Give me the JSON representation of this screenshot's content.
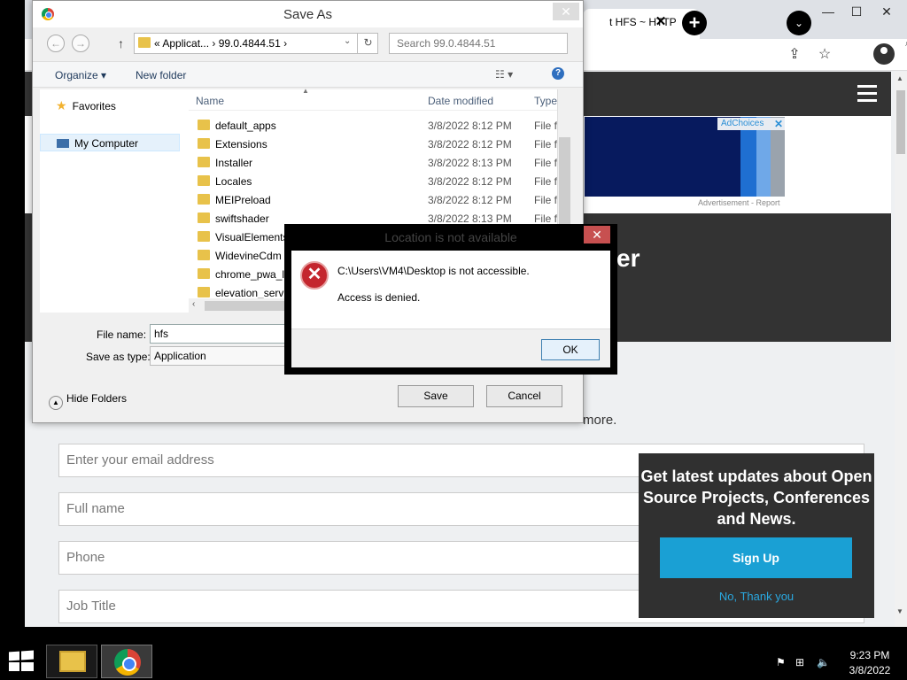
{
  "chrome": {
    "tab_title": "t HFS ~ HTTP",
    "tab_close": "✕",
    "new_tab": "+",
    "tab_search": "⌄",
    "minimize": "—",
    "maximize": "☐",
    "close": "✕",
    "share_icon": "⇪",
    "star_icon": "☆",
    "menu_icon": "⋮"
  },
  "page": {
    "adchoices": "AdChoices",
    "adchoices_close": "✕",
    "ad_label": "Advertisement - Report",
    "hero_partial": "er",
    "subscribe_partial": "more.",
    "form": {
      "email_placeholder": "Enter your email address",
      "fullname_placeholder": "Full name",
      "phone_placeholder": "Phone",
      "jobtitle_placeholder": "Job Title"
    },
    "popup": {
      "title": "Get latest updates about Open Source Projects, Conferences and News.",
      "signup": "Sign Up",
      "nothanks": "No, Thank you"
    }
  },
  "saveas": {
    "title": "Save As",
    "close": "✕",
    "back": "←",
    "forward": "→",
    "up": "↑",
    "address": "« Applicat... › 99.0.4844.51 ›",
    "address_dd": "⌄",
    "refresh": "↻",
    "search_placeholder": "Search 99.0.4844.51",
    "organize": "Organize ▾",
    "new_folder": "New folder",
    "view_options": "☷ ▾",
    "help": "?",
    "nav": {
      "favorites": "Favorites",
      "my_computer": "My Computer"
    },
    "columns": {
      "name": "Name",
      "date": "Date modified",
      "type": "Type"
    },
    "files": [
      {
        "name": "default_apps",
        "date": "3/8/2022 8:12 PM",
        "type": "File fol"
      },
      {
        "name": "Extensions",
        "date": "3/8/2022 8:12 PM",
        "type": "File fol"
      },
      {
        "name": "Installer",
        "date": "3/8/2022 8:13 PM",
        "type": "File fol"
      },
      {
        "name": "Locales",
        "date": "3/8/2022 8:12 PM",
        "type": "File fol"
      },
      {
        "name": "MEIPreload",
        "date": "3/8/2022 8:12 PM",
        "type": "File fol"
      },
      {
        "name": "swiftshader",
        "date": "3/8/2022 8:13 PM",
        "type": "File fol"
      },
      {
        "name": "VisualElements",
        "date": "",
        "type": ""
      },
      {
        "name": "WidevineCdm",
        "date": "",
        "type": ""
      },
      {
        "name": "chrome_pwa_la",
        "date": "",
        "type": ""
      },
      {
        "name": "elevation_servic",
        "date": "",
        "type": ""
      }
    ],
    "filename_label": "File name:",
    "filename_value": "hfs",
    "savetype_label": "Save as type:",
    "savetype_value": "Application",
    "hide_folders": "Hide Folders",
    "save": "Save",
    "cancel": "Cancel"
  },
  "error_dialog": {
    "title": "Location is not available",
    "close": "✕",
    "icon": "✕",
    "message1": "C:\\Users\\VM4\\Desktop is not accessible.",
    "message2": "Access is denied.",
    "ok": "OK"
  },
  "taskbar": {
    "time": "9:23 PM",
    "date": "3/8/2022"
  }
}
